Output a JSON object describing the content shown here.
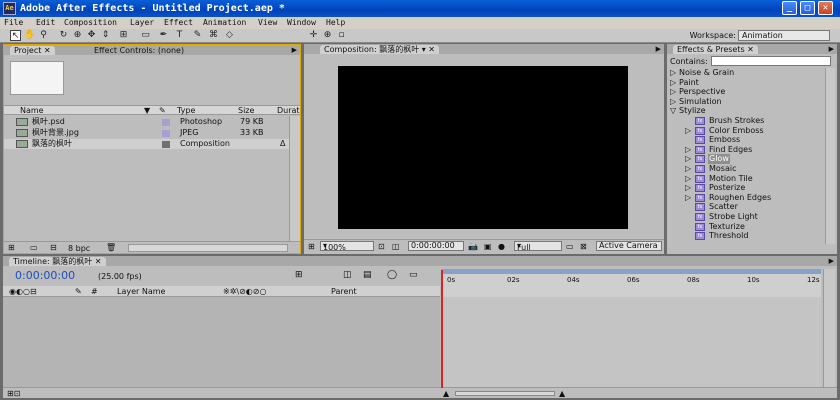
{
  "window": {
    "title": "Adobe After Effects - Untitled Project.aep *"
  },
  "menu": [
    "File",
    "Edit",
    "Composition",
    "Layer",
    "Effect",
    "Animation",
    "View",
    "Window",
    "Help"
  ],
  "workspace": {
    "label": "Workspace:",
    "value": "Animation"
  },
  "project_panel": {
    "tabs": [
      "Project",
      "Effect Controls: (none)"
    ],
    "columns": [
      "Name",
      "Type",
      "Size",
      "Durat"
    ],
    "items": [
      {
        "name": "枫叶.psd",
        "type": "Photoshop",
        "size": "79 KB",
        "dur": "",
        "label_color": "#a89fd0"
      },
      {
        "name": "枫叶背景.jpg",
        "type": "JPEG",
        "size": "33 KB",
        "dur": "",
        "label_color": "#a89fd0"
      },
      {
        "name": "飘落的枫叶",
        "type": "Composition",
        "size": "",
        "dur": "Δ",
        "label_color": "#707070"
      }
    ],
    "bpc": "8 bpc"
  },
  "comp_panel": {
    "tab": "Composition: 飘落的枫叶",
    "zoom": "100%",
    "timecode": "0:00:00:00",
    "resolution": "Full",
    "camera": "Active Camera"
  },
  "effects_panel": {
    "tab": "Effects & Presets",
    "contains_label": "Contains:",
    "categories_top": [
      "Noise & Grain",
      "Paint",
      "Perspective",
      "Simulation",
      "Stylize"
    ],
    "stylize_items": [
      "Brush Strokes",
      "Color Emboss",
      "Emboss",
      "Find Edges",
      "Glow",
      "Mosaic",
      "Motion Tile",
      "Posterize",
      "Roughen Edges",
      "Scatter",
      "Strobe Light",
      "Texturize",
      "Threshold"
    ],
    "selected": "Glow"
  },
  "timeline": {
    "tab": "Timeline: 飘落的枫叶",
    "timecode": "0:00:00:00",
    "fps": "(25.00 fps)",
    "columns": {
      "hash": "#",
      "layer_name": "Layer Name",
      "parent": "Parent"
    },
    "ruler": [
      "0s",
      "02s",
      "04s",
      "06s",
      "08s",
      "10s",
      "12s"
    ]
  }
}
